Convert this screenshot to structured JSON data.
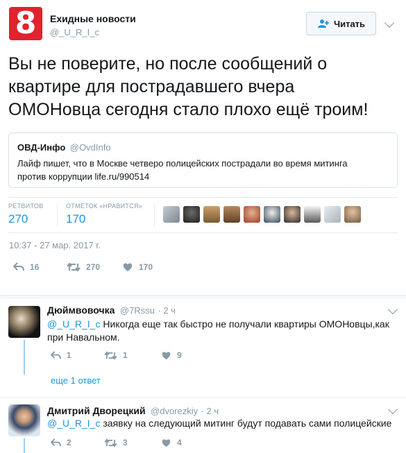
{
  "author": {
    "name": "Ехидные новости",
    "handle": "@_U_R_I_c",
    "avatar_char": "8"
  },
  "follow_button": {
    "label": "Читать"
  },
  "tweet": {
    "text_lines": [
      "Вы не поверите, но после сообщений о",
      "квартире для пострадавшего вчера",
      "ОМОНовца сегодня стало плохо ещё троим!"
    ],
    "timestamp": "10:37 - 27 мар. 2017 г."
  },
  "quote": {
    "name": "ОВД-Инфо",
    "handle": "@OvdInfo",
    "line1": "Лайф пишет, что в Москве четверо полицейских пострадали во время  митинга",
    "line2": "против коррупции life.ru/990514"
  },
  "stats": {
    "retweets_label": "РЕТВИТОВ",
    "retweets": "270",
    "likes_label": "ОТМЕТОК «НРАВИТСЯ»",
    "likes": "170"
  },
  "actions": {
    "replies": "16",
    "retweets": "270",
    "likes": "170"
  },
  "colors": {
    "accent": "#1b95e0",
    "brand": "#e0232e",
    "muted": "#8899a6"
  },
  "replies": [
    {
      "name": "Дюймвовочка",
      "handle": "@7Rssu",
      "time": "· 2 ч",
      "mention": "@_U_R_I_c",
      "text_line1": "Никогда еще так быстро не получали квартиры ОМОНовцы,как",
      "text_line2": "при Навальном.",
      "replies": "1",
      "retweets": "1",
      "likes": "9",
      "more": "еще 1 ответ"
    },
    {
      "name": "Дмитрий Дворецкий",
      "handle": "@dvorezkiy",
      "time": "· 2 ч",
      "mention": "@_U_R_I_c",
      "text_line1": "заявку на следующий митинг будут подавать сами полицейские",
      "replies": "2",
      "retweets": "3",
      "likes": "4"
    }
  ]
}
